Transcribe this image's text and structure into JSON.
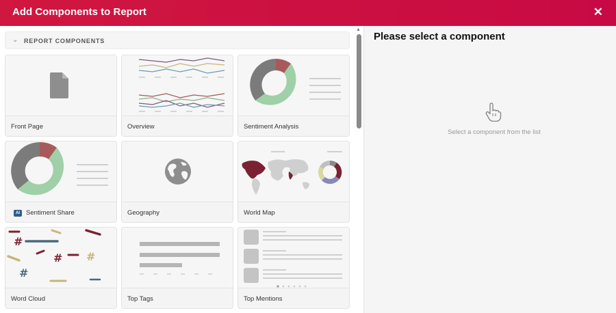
{
  "dialog": {
    "title": "Add Components to Report",
    "close_icon": "close-icon",
    "close_glyph": "✕"
  },
  "section": {
    "label": "REPORT COMPONENTS",
    "collapse_icon": "chevron-down-icon",
    "chevron_glyph": "⌄"
  },
  "components": [
    {
      "label": "Front Page",
      "thumb": "document-icon"
    },
    {
      "label": "Overview",
      "thumb": "line-chart"
    },
    {
      "label": "Sentiment Analysis",
      "thumb": "donut-chart"
    },
    {
      "label": "Sentiment Share",
      "thumb": "donut-chart",
      "badge": "AI"
    },
    {
      "label": "Geography",
      "thumb": "globe-icon"
    },
    {
      "label": "World Map",
      "thumb": "world-map"
    },
    {
      "label": "Word Cloud",
      "thumb": "word-cloud"
    },
    {
      "label": "Top Tags",
      "thumb": "bar-list"
    },
    {
      "label": "Top Mentions",
      "thumb": "mention-list"
    }
  ],
  "detail": {
    "title": "Please select a component",
    "hint": "Select a component from the list",
    "icon": "pointer-hand-icon"
  },
  "colors": {
    "header_gradient_start": "#d0173f",
    "header_gradient_end": "#c80a44",
    "donut_green": "#9fd0a8",
    "donut_gray": "#7b7b7b",
    "donut_red": "#a85a5a",
    "map_red": "#7a2233",
    "ai_badge": "#2f5d8c"
  }
}
